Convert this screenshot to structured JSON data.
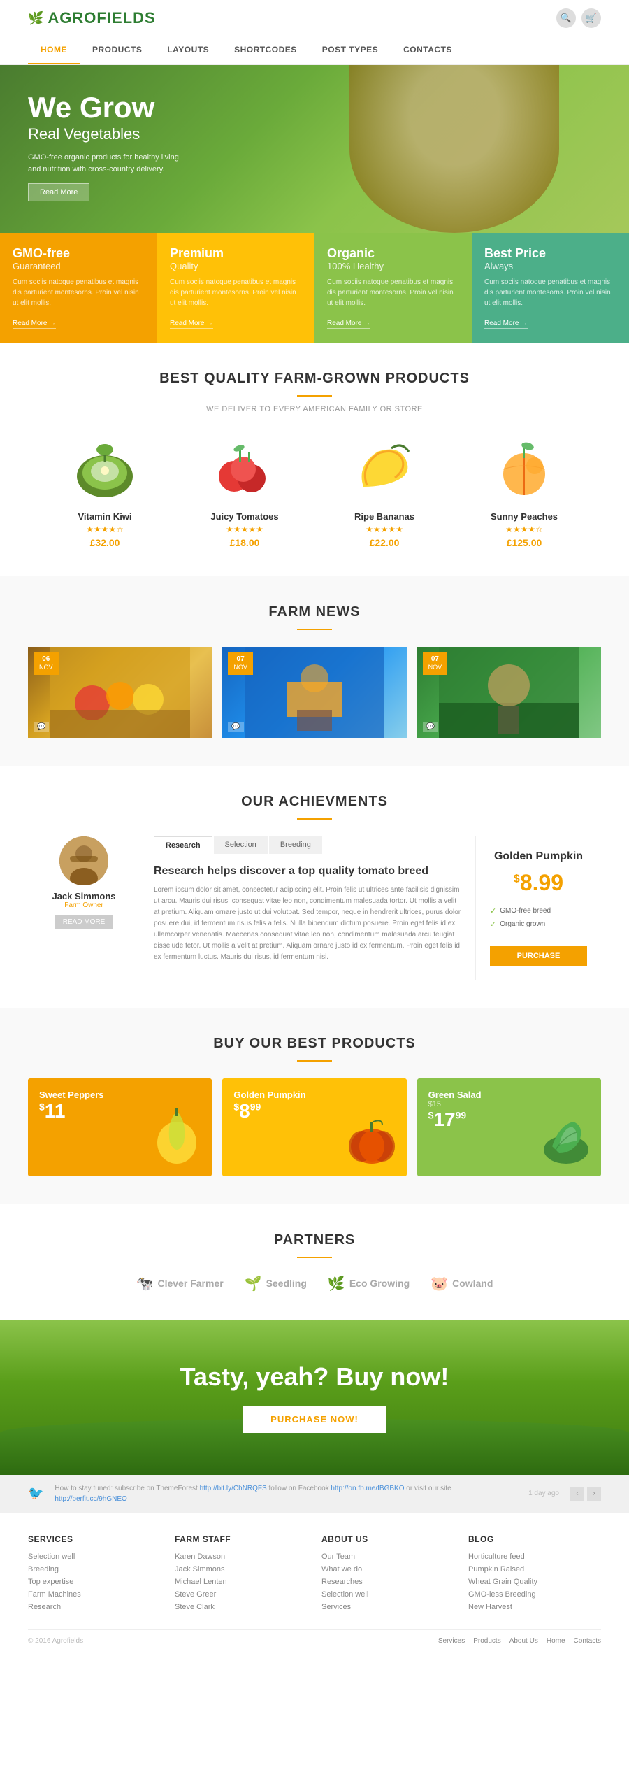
{
  "brand": {
    "name": "AGROFIELDS",
    "icon": "🌿"
  },
  "nav": {
    "items": [
      {
        "label": "HOME",
        "active": true
      },
      {
        "label": "PRODUCTS",
        "active": false
      },
      {
        "label": "LAYOUTS",
        "active": false
      },
      {
        "label": "SHORTCODES",
        "active": false
      },
      {
        "label": "POST TYPES",
        "active": false
      },
      {
        "label": "CONTACTS",
        "active": false
      }
    ]
  },
  "hero": {
    "title": "We Grow",
    "subtitle": "Real Vegetables",
    "description": "GMO-free organic products for healthy living and nutrition with cross-country delivery.",
    "button_label": "Read More"
  },
  "feature_boxes": [
    {
      "title": "GMO-free",
      "subtitle": "Guaranteed",
      "text": "Cum sociis natoque penatibus et magnis dis parturient montesorns. Proin vel nisin ut elit mollis.",
      "link": "Read More →",
      "color": "orange"
    },
    {
      "title": "Premium",
      "subtitle": "Quality",
      "text": "Cum sociis natoque penatibus et magnis dis parturient montesorns. Proin vel nisin ut elit mollis.",
      "link": "Read More →",
      "color": "yellow"
    },
    {
      "title": "Organic",
      "subtitle": "100% Healthy",
      "text": "Cum sociis natoque penatibus et magnis dis parturient montesorns. Proin vel nisin ut elit mollis.",
      "link": "Read More →",
      "color": "green"
    },
    {
      "title": "Best Price",
      "subtitle": "Always",
      "text": "Cum sociis natoque penatibus et magnis dis parturient montesorns. Proin vel nisin ut elit mollis.",
      "link": "Read More →",
      "color": "teal"
    }
  ],
  "products_section": {
    "title": "BEST QUALITY FARM-GROWN PRODUCTS",
    "subtitle": "WE DELIVER TO EVERY AMERICAN FAMILY OR STORE",
    "items": [
      {
        "name": "Vitamin Kiwi",
        "price": "£32.00",
        "stars": 4
      },
      {
        "name": "Juicy Tomatoes",
        "price": "£18.00",
        "stars": 5
      },
      {
        "name": "Ripe Bananas",
        "price": "£22.00",
        "stars": 5
      },
      {
        "name": "Sunny Peaches",
        "price": "£125.00",
        "stars": 4
      }
    ]
  },
  "news_section": {
    "title": "FARM NEWS",
    "items": [
      {
        "day": "06",
        "month": "NOV",
        "color": "#d4a020"
      },
      {
        "day": "07",
        "month": "NOV",
        "color": "#3a7abf"
      },
      {
        "day": "07",
        "month": "NOV",
        "color": "#4a8a30"
      }
    ]
  },
  "achievements_section": {
    "title": "OUR ACHIEVMENTS",
    "person": {
      "name": "Jack Simmons",
      "role": "Farm Owner",
      "button": "READ MORE"
    },
    "tabs": [
      "Research",
      "Selection",
      "Breeding"
    ],
    "active_tab": "Research",
    "content_title": "Research helps discover a top quality tomato breed",
    "content_text": "Lorem ipsum dolor sit amet, consectetur adipiscing elit. Proin felis ut ultrices ante facilisis dignissim ut arcu. Mauris dui risus, consequat vitae leo non, condimentum malesuada tortor. Ut mollis a velit at pretium. Aliquam ornare justo ut dui volutpat. Sed tempor, neque in hendrerit ultrices, purus dolor posuere dui, id fermentum risus felis a felis. Nulla bibendum dictum posuere. Proin eget felis id ex ullamcorper venenatis. Maecenas consequat vitae leo non, condimentum malesuada arcu feugiat disselude fetor. Ut mollis a velit at pretium. Aliquam ornare justo id ex fermentum. Proin eget felis id ex fermentum luctus. Mauris dui risus, id fermentum nisi.",
    "product": {
      "name": "Golden Pumpkin",
      "price": "8.99",
      "currency": "$",
      "features": [
        "GMO-free breed",
        "Organic grown"
      ],
      "button": "PURCHASE"
    }
  },
  "best_products_section": {
    "title": "BUY OUR BEST PRODUCTS",
    "items": [
      {
        "label": "Sweet Peppers",
        "price": "11",
        "old_price": null,
        "currency": "$",
        "color": "orange"
      },
      {
        "label": "Golden Pumpkin",
        "price": "8",
        "price_cents": "99",
        "currency": "$",
        "color": "yellow"
      },
      {
        "label": "Green Salad",
        "price": "17",
        "price_cents": "99",
        "old_price": "15",
        "currency": "$",
        "color": "green"
      }
    ]
  },
  "partners_section": {
    "title": "PARTNERS",
    "items": [
      {
        "name": "Clever Farmer",
        "icon": "🐄"
      },
      {
        "name": "Seedling",
        "icon": "🌱"
      },
      {
        "name": "Eco Growing",
        "icon": "🌿"
      },
      {
        "name": "Cowland",
        "icon": "🐷"
      }
    ]
  },
  "cta_section": {
    "title": "Tasty, yeah? Buy now!",
    "button": "PURCHASE NOW!"
  },
  "social_bar": {
    "text": "How to stay tuned: subscribe on ThemeForest",
    "link1": "http://bit.ly/ChNRQFS",
    "text2": "follow on Facebook",
    "link2": "http://on.fb.me/fBGBKO",
    "text3": "or visit our site",
    "link3": "http://perfit.cc/9hGNEO",
    "time": "1 day ago"
  },
  "footer": {
    "columns": [
      {
        "title": "SERVICES",
        "links": [
          "Selection well",
          "Breeding",
          "Top expertise",
          "Farm Machines",
          "Research"
        ]
      },
      {
        "title": "FARM STAFF",
        "links": [
          "Karen Dawson",
          "Jack Simmons",
          "Michael Lenten",
          "Steve Greer",
          "Steve Clark"
        ]
      },
      {
        "title": "ABOUT US",
        "links": [
          "Our Team",
          "What we do",
          "Researches",
          "Selection well",
          "Services"
        ]
      },
      {
        "title": "BLOG",
        "links": [
          "Horticulture feed",
          "Pumpkin Raised",
          "Wheat Grain Quality",
          "GMO-less Breeding",
          "New Harvest"
        ]
      }
    ],
    "copyright": "© 2016 Agrofields",
    "nav_items": [
      "Services",
      "Products",
      "About Us",
      "Home",
      "Contacts"
    ]
  }
}
